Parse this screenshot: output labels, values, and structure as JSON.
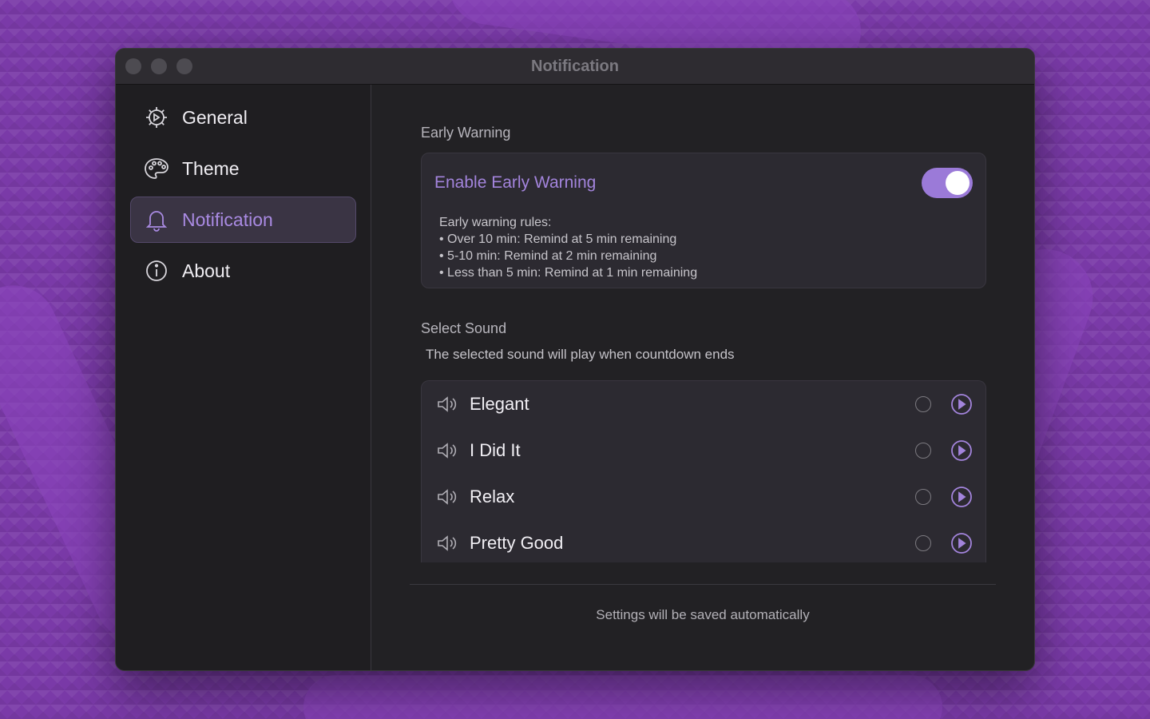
{
  "window": {
    "title": "Notification"
  },
  "sidebar": {
    "items": [
      {
        "label": "General",
        "icon": "gear-icon"
      },
      {
        "label": "Theme",
        "icon": "palette-icon"
      },
      {
        "label": "Notification",
        "icon": "bell-icon",
        "active": true
      },
      {
        "label": "About",
        "icon": "info-icon"
      }
    ]
  },
  "early_warning": {
    "section_title": "Early Warning",
    "toggle_label": "Enable Early Warning",
    "enabled": true,
    "rules": [
      "Early warning rules:",
      "• Over 10 min: Remind at 5 min remaining",
      "• 5-10 min: Remind at 2 min remaining",
      "• Less than 5 min: Remind at 1 min remaining"
    ]
  },
  "sound": {
    "section_title": "Select Sound",
    "subtitle": "The selected sound will play when countdown ends",
    "items": [
      {
        "name": "Elegant"
      },
      {
        "name": "I Did It"
      },
      {
        "name": "Relax"
      },
      {
        "name": "Pretty Good"
      }
    ]
  },
  "footer": {
    "text": "Settings will be saved automatically"
  },
  "colors": {
    "accent": "#9b7ad8",
    "accent_text": "#a384dc",
    "window_bg": "#222124"
  }
}
